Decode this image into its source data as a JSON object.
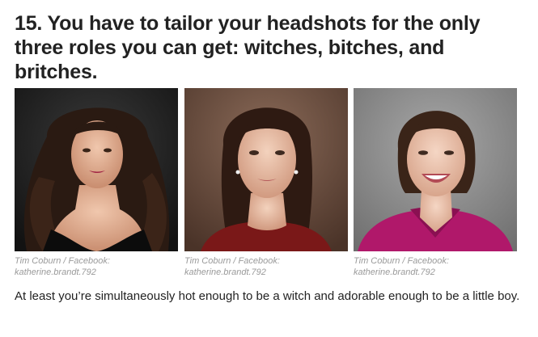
{
  "heading": "15. You have to tailor your headshots for the only three roles you can get: witches, bitches, and britches.",
  "photos": [
    {
      "credit_line1": "Tim Coburn / Facebook:",
      "credit_line2": "katherine.brandt.792",
      "background": "#2a2a2a",
      "outfit": "#111111"
    },
    {
      "credit_line1": "Tim Coburn / Facebook:",
      "credit_line2": "katherine.brandt.792",
      "background": "#6b5044",
      "outfit": "#8a1a1a"
    },
    {
      "credit_line1": "Tim Coburn / Facebook:",
      "credit_line2": "katherine.brandt.792",
      "background": "#8f8f8f",
      "outfit": "#b0186a"
    }
  ],
  "caption": "At least you’re simultaneously hot enough to be a witch and adorable enough to be a little boy."
}
